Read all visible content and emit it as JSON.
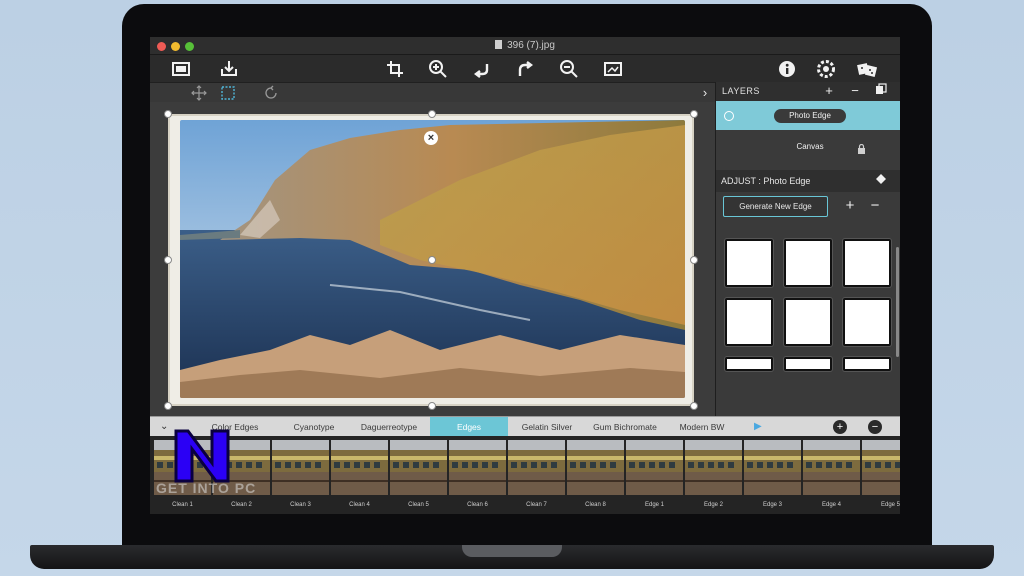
{
  "window": {
    "title": "396 (7).jpg"
  },
  "toolbar": {
    "icons": [
      "browse-photo-icon",
      "export-icon",
      "crop-icon",
      "zoom-in-icon",
      "undo-icon",
      "redo-icon",
      "zoom-out-icon",
      "fit-to-screen-icon",
      "info-icon",
      "settings-icon",
      "random-dice-icon"
    ]
  },
  "subtoolbar": {
    "icons": [
      "move-icon",
      "select-icon",
      "rotate-icon",
      "chevron-right-icon"
    ]
  },
  "layers": {
    "header": "LAYERS",
    "items": [
      {
        "label": "Photo Edge",
        "selected": true
      },
      {
        "label": "Canvas",
        "locked": true
      }
    ]
  },
  "adjust": {
    "header": "ADJUST : Photo Edge",
    "generate_button": "Generate New Edge",
    "thumbnail_count": 9
  },
  "filters": {
    "tabs": [
      "Color Edges",
      "Cyanotype",
      "Daguerreotype",
      "Edges",
      "Gelatin Silver",
      "Gum Bichromate",
      "Modern BW"
    ],
    "active": "Edges"
  },
  "filmstrip": {
    "items": [
      "Clean 1",
      "Clean 2",
      "Clean 3",
      "Clean 4",
      "Clean 5",
      "Clean 6",
      "Clean 7",
      "Clean 8",
      "Edge 1",
      "Edge 2",
      "Edge 3",
      "Edge 4",
      "Edge 5"
    ]
  },
  "watermark": {
    "letter": "N",
    "text": "GET INTO PC"
  },
  "colors": {
    "accent": "#6cc6d6",
    "selected_layer": "#7fcad8",
    "window_bg": "#2b2b2b"
  }
}
